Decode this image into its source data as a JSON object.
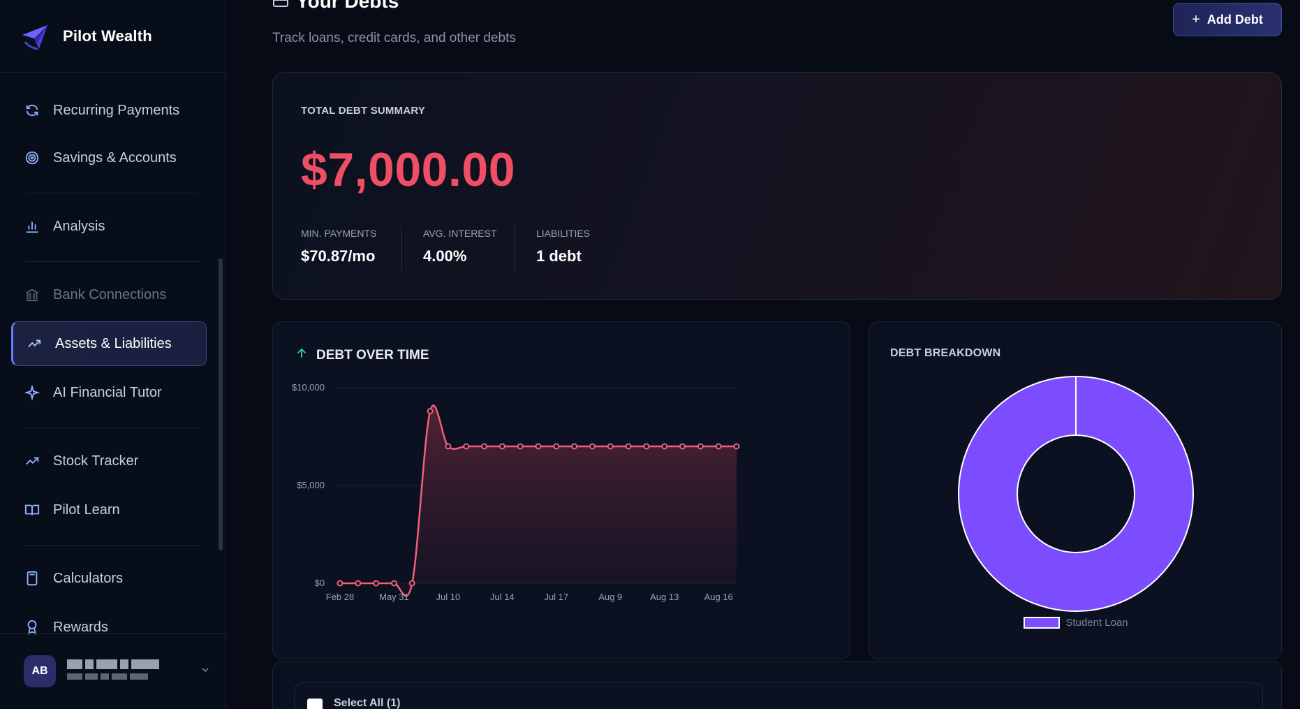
{
  "brand": {
    "name": "Pilot Wealth"
  },
  "sidebar": {
    "items": [
      {
        "label": "Recurring Payments",
        "icon": "refresh-icon"
      },
      {
        "label": "Savings & Accounts",
        "icon": "target-icon"
      },
      {
        "label": "Analysis",
        "icon": "bar-chart-icon"
      },
      {
        "label": "Bank Connections",
        "icon": "bank-icon"
      },
      {
        "label": "Assets & Liabilities",
        "icon": "trending-up-icon",
        "active": true
      },
      {
        "label": "AI Financial Tutor",
        "icon": "sparkle-icon"
      },
      {
        "label": "Stock Tracker",
        "icon": "trending-up-icon"
      },
      {
        "label": "Pilot Learn",
        "icon": "book-icon"
      },
      {
        "label": "Calculators",
        "icon": "calculator-icon"
      },
      {
        "label": "Rewards",
        "icon": "award-icon"
      }
    ]
  },
  "user": {
    "initials": "AB"
  },
  "header": {
    "title": "Your Debts",
    "subtitle": "Track loans, credit cards, and other debts",
    "add_button": "Add Debt"
  },
  "summary": {
    "caption": "TOTAL DEBT SUMMARY",
    "total": "$7,000.00",
    "stats": [
      {
        "label": "MIN. PAYMENTS",
        "value": "$70.87/mo"
      },
      {
        "label": "AVG. INTEREST",
        "value": "4.00%"
      },
      {
        "label": "LIABILITIES",
        "value": "1 debt"
      }
    ]
  },
  "debt_chart": {
    "title": "DEBT OVER TIME"
  },
  "breakdown": {
    "title": "DEBT BREAKDOWN"
  },
  "table": {
    "select_all": "Select All (1)"
  },
  "colors": {
    "accent": "#7c4dff",
    "danger": "#ef4f64",
    "line": "#f0607a",
    "positive": "#34d399"
  },
  "chart_data": [
    {
      "type": "area",
      "title": "DEBT OVER TIME",
      "x_tick_labels": [
        "Feb 28",
        "May 31",
        "Jul 10",
        "Jul 14",
        "Jul 17",
        "Aug 9",
        "Aug 13",
        "Aug 16"
      ],
      "y_tick_labels": [
        "$0",
        "$5,000",
        "$10,000"
      ],
      "ylim": [
        0,
        10000
      ],
      "series": [
        {
          "values": [
            0,
            0,
            0,
            0,
            0,
            8800,
            7000,
            7000,
            7000,
            7000,
            7000,
            7000,
            7000,
            7000,
            7000,
            7000,
            7000,
            7000,
            7000,
            7000,
            7000,
            7000,
            7000
          ]
        }
      ],
      "grid": true
    },
    {
      "type": "pie",
      "title": "DEBT BREAKDOWN",
      "categories": [
        "Student Loan"
      ],
      "values": [
        7000
      ],
      "legend": "bottom"
    }
  ]
}
